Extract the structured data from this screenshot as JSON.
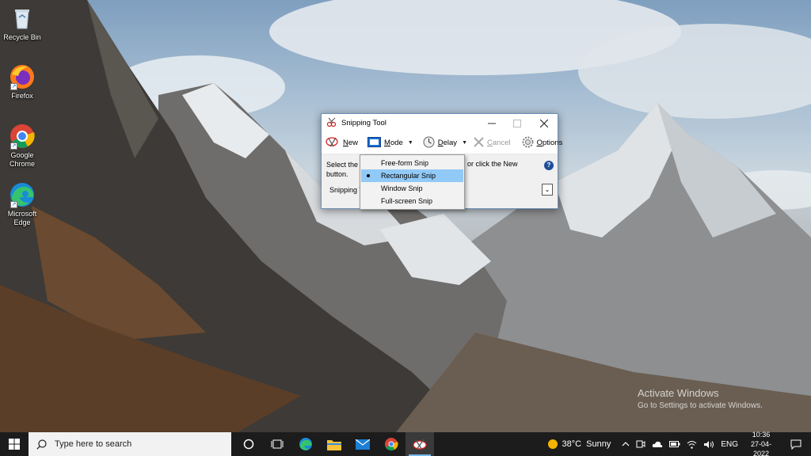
{
  "desktop": {
    "icons": [
      {
        "label": "Recycle Bin",
        "icon": "recycle-bin-icon"
      },
      {
        "label": "Firefox",
        "icon": "firefox-icon"
      },
      {
        "label": "Google Chrome",
        "icon": "chrome-icon"
      },
      {
        "label": "Microsoft Edge",
        "icon": "edge-icon"
      }
    ]
  },
  "snipping_tool": {
    "title": "Snipping Tool",
    "toolbar": {
      "new_label": "New",
      "mode_label": "Mode",
      "delay_label": "Delay",
      "cancel_label": "Cancel",
      "options_label": "Options"
    },
    "message_line1": "Select the",
    "message_line2": "button.",
    "message_tail": "or click the New",
    "status": "Snipping T",
    "help": "?"
  },
  "mode_menu": {
    "items": [
      "Free-form Snip",
      "Rectangular Snip",
      "Window Snip",
      "Full-screen Snip"
    ],
    "selected": "Rectangular Snip"
  },
  "watermark": {
    "title": "Activate Windows",
    "subtitle": "Go to Settings to activate Windows."
  },
  "taskbar": {
    "search_placeholder": "Type here to search",
    "weather_temp": "38°C",
    "weather_condition": "Sunny",
    "language": "ENG",
    "time": "10:36",
    "date": "27-04-2022"
  },
  "colors": {
    "accent": "#0078d7",
    "menu_highlight": "#91c9f7",
    "taskbar": "#1c1c1c"
  }
}
